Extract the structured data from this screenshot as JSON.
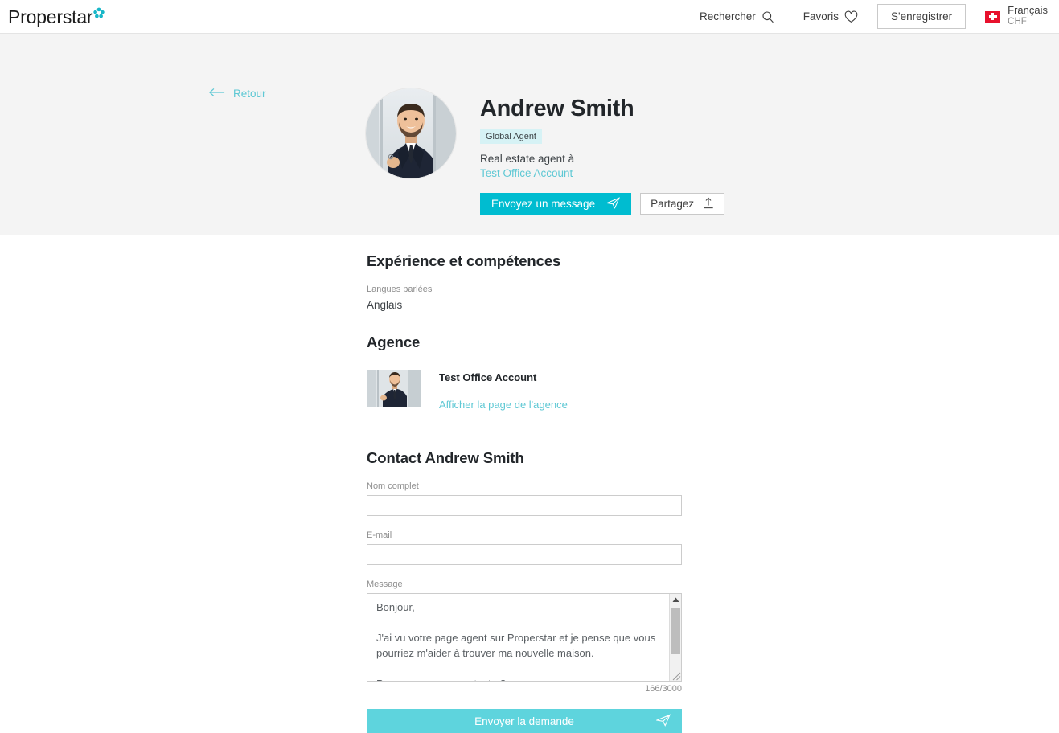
{
  "header": {
    "logo_text": "Properstar",
    "logo_icon": "star-flower-icon",
    "search_label": "Rechercher",
    "search_icon": "search-icon",
    "favorites_label": "Favoris",
    "favorites_icon": "heart-icon",
    "register_label": "S'enregistrer",
    "flag_icon": "swiss-flag-icon",
    "language": "Français",
    "currency": "CHF"
  },
  "hero": {
    "back_label": "Retour",
    "back_icon": "arrow-left-icon",
    "avatar_alt": "Andrew Smith profile photo",
    "agent_name": "Andrew Smith",
    "badge": "Global Agent",
    "role_text": "Real estate agent à",
    "agency_link": "Test Office Account",
    "message_button": "Envoyez un message",
    "message_button_icon": "paper-plane-icon",
    "share_button": "Partagez",
    "share_button_icon": "share-upload-icon"
  },
  "experience": {
    "title": "Expérience et compétences",
    "languages_label": "Langues parlées",
    "languages_value": "Anglais"
  },
  "agency": {
    "title": "Agence",
    "thumb_alt": "Test Office Account photo",
    "name": "Test Office Account",
    "page_link": "Afficher la page de l'agence"
  },
  "contact": {
    "title": "Contact Andrew Smith",
    "name_label": "Nom complet",
    "name_value": "",
    "name_placeholder": "",
    "email_label": "E-mail",
    "email_value": "",
    "email_placeholder": "",
    "message_label": "Message",
    "message_value": "Bonjour,\n\nJ'ai vu votre page agent sur Properstar et je pense que vous pourriez m'aider à trouver ma nouvelle maison.\n\nPouvez-vous me contacter?",
    "counter": "166/3000",
    "submit_label": "Envoyer la demande",
    "submit_icon": "paper-plane-icon"
  },
  "colors": {
    "brand_teal": "#00bcd0",
    "light_teal": "#5ed4dd",
    "link_teal": "#5ec8d4",
    "badge_bg": "#d6f2f5",
    "hero_bg": "#f4f4f4",
    "flag_red": "#e8112d"
  }
}
